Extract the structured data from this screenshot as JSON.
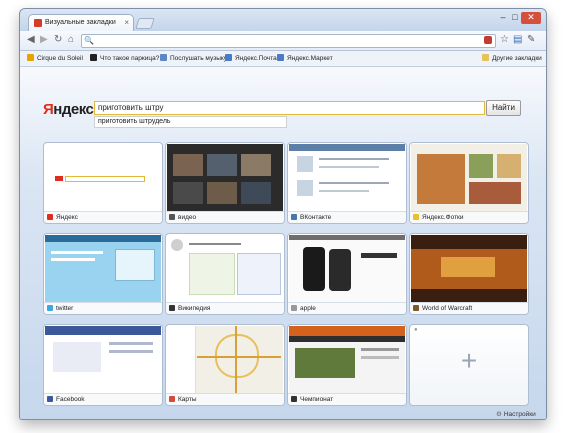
{
  "browser": {
    "tab_title": "Визуальные закладки",
    "tab_close": "×",
    "window_controls": {
      "minimize": "–",
      "maximize": "□",
      "close": "✕"
    },
    "toolbar": {
      "back": "◀",
      "forward": "▶",
      "reload": "↻",
      "home": "⌂",
      "search_glyph": "🔍",
      "star": "☆",
      "page": "▤",
      "wrench": "✎"
    },
    "bookmarks": [
      {
        "label": "Cirque du Soleil"
      },
      {
        "label": "Что такое паркица?"
      },
      {
        "label": "Послушать музыку"
      },
      {
        "label": "Яндекс.Почта"
      },
      {
        "label": "Яндекс.Маркет"
      }
    ],
    "other_bookmarks": "Другие закладки"
  },
  "yandex": {
    "logo_first": "Я",
    "logo_rest": "ндекс",
    "query": "приготовить штру",
    "suggestion": "приготовить штрудель",
    "button": "Найти"
  },
  "tiles": [
    {
      "label": "Яндекс",
      "favicon_color": "#e02b1d"
    },
    {
      "label": "видео",
      "favicon_color": "#555555"
    },
    {
      "label": "ВКонтакте",
      "favicon_color": "#4a76a8"
    },
    {
      "label": "Яндекс.Фотки",
      "favicon_color": "#e8c02e"
    },
    {
      "label": "twitter",
      "favicon_color": "#3fa7dd"
    },
    {
      "label": "Википедия",
      "favicon_color": "#333333"
    },
    {
      "label": "apple",
      "favicon_color": "#999999"
    },
    {
      "label": "World of Warcraft",
      "favicon_color": "#7a5a2a"
    },
    {
      "label": "Facebook",
      "favicon_color": "#3b5998"
    },
    {
      "label": "Карты",
      "favicon_color": "#d64a3a"
    },
    {
      "label": "Чемпионат",
      "favicon_color": "#333333"
    }
  ],
  "add_tile": {
    "plus": "+"
  },
  "settings": {
    "gear": "⚙",
    "label": "Настройки"
  },
  "colors": {
    "yandex_red": "#e02b1d",
    "accent_blue": "#4a76a8",
    "search_border": "#e0b93d"
  }
}
